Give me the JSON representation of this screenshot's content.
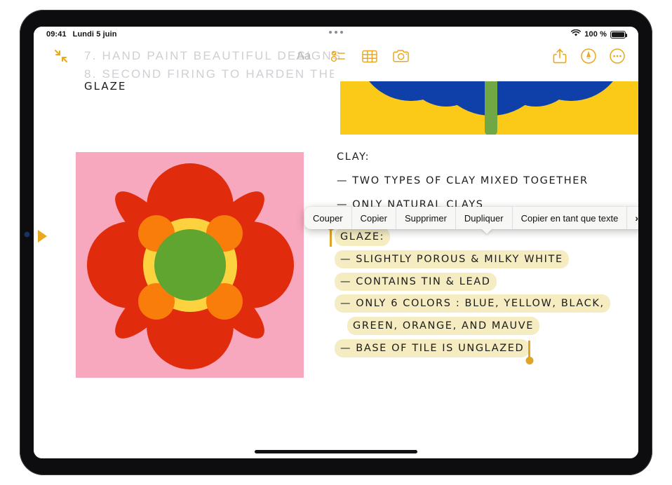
{
  "status_bar": {
    "time": "09:41",
    "date": "Lundi 5 juin",
    "wifi_icon": "wifi-icon",
    "battery_text": "100 %",
    "battery_icon": "battery-icon"
  },
  "toolbar": {
    "collapse_icon": "collapse-arrows-icon",
    "format_label": "Aa",
    "checklist_icon": "checklist-icon",
    "table_icon": "table-icon",
    "camera_icon": "camera-icon",
    "share_icon": "share-icon",
    "markup_icon": "markup-pen-icon",
    "more_icon": "more-ellipsis-icon",
    "compose_icon": "compose-icon"
  },
  "multitask": {
    "handle_icon": "multitask-dots-icon"
  },
  "document": {
    "faded_lines": [
      "7. HAND PAINT BEAUTIFUL DESIGNS",
      "8. SECOND FIRING TO HARDEN THE"
    ],
    "left_heading": "GLAZE",
    "clay_section": {
      "heading": "CLAY:",
      "items": [
        "— TWO TYPES OF CLAY MIXED TOGETHER",
        "— ONLY NATURAL CLAYS"
      ]
    },
    "glaze_section": {
      "heading": "GLAZE:",
      "items": [
        "— SLIGHTLY POROUS & MILKY WHITE",
        "— CONTAINS TIN & LEAD",
        "— ONLY 6 COLORS : BLUE, YELLOW, BLACK,",
        "GREEN, ORANGE, AND MAUVE",
        "— BASE OF TILE IS UNGLAZED"
      ]
    }
  },
  "context_menu": {
    "items": [
      {
        "label": "Couper"
      },
      {
        "label": "Copier"
      },
      {
        "label": "Supprimer"
      },
      {
        "label": "Dupliquer"
      },
      {
        "label": "Copier en tant que texte"
      }
    ],
    "more_chevron": "›"
  },
  "selection": {
    "start_handle_icon": "selection-start-handle",
    "end_handle_icon": "selection-end-handle",
    "highlight_color": "#f5ecc2",
    "handle_color": "#e0a526"
  },
  "markers": {
    "left_marker_icon": "play-triangle-marker"
  },
  "drawings": {
    "flower_tile": {
      "name": "flower-tile-drawing",
      "background": "#f7a8be",
      "petal_color": "#e02b0c",
      "ring_color": "#fcd33f",
      "center_color": "#5fa530",
      "dot_color": "#f97d0a"
    },
    "top_tile": {
      "name": "blue-yellow-tile-drawing",
      "background": "#fbc918",
      "arc_color": "#0f3fa8",
      "stem_color": "#6fa845"
    }
  },
  "home_indicator": {
    "icon": "home-indicator"
  }
}
